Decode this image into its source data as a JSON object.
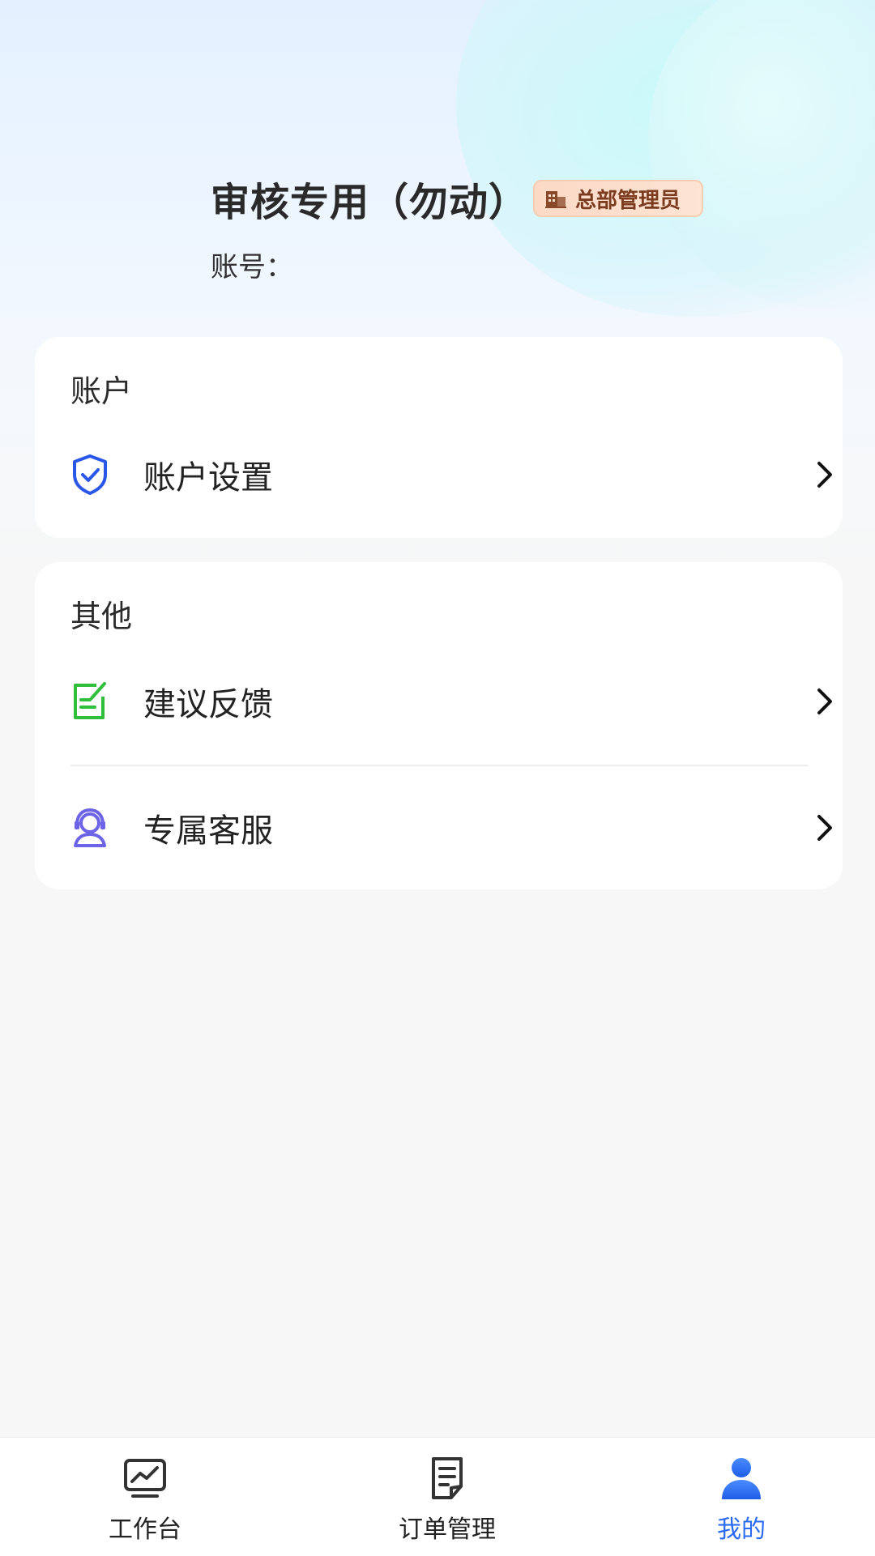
{
  "profile": {
    "name": "审核专用（勿动）",
    "role_badge": "总部管理员",
    "account_label": "账号："
  },
  "sections": [
    {
      "title": "账户",
      "items": [
        {
          "label": "账户设置",
          "icon": "shield-check-icon",
          "icon_color": "#2a57e8"
        }
      ]
    },
    {
      "title": "其他",
      "items": [
        {
          "label": "建议反馈",
          "icon": "feedback-edit-icon",
          "icon_color": "#2fbf3a"
        },
        {
          "label": "专属客服",
          "icon": "customer-service-icon",
          "icon_color": "#6c63e6"
        }
      ]
    }
  ],
  "tabbar": {
    "tabs": [
      {
        "label": "工作台",
        "icon": "chart-monitor-icon",
        "active": false
      },
      {
        "label": "订单管理",
        "icon": "document-list-icon",
        "active": false
      },
      {
        "label": "我的",
        "icon": "user-icon",
        "active": true
      }
    ]
  },
  "colors": {
    "accent": "#2a6bf2",
    "badge_bg": "#fde4d3",
    "badge_text": "#7a3b1e",
    "page_bg": "#f7f7f7"
  }
}
